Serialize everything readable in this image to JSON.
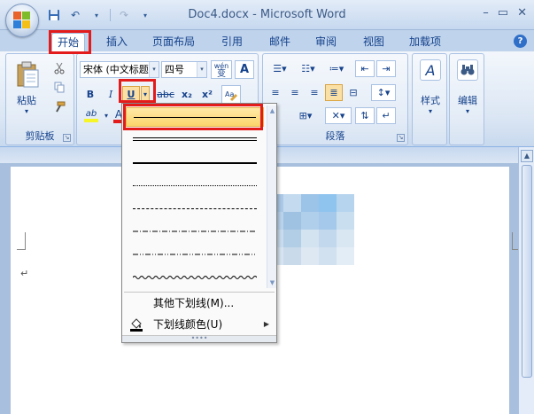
{
  "window": {
    "title": "Doc4.docx - Microsoft Word",
    "minimize": "–",
    "restore": "▭",
    "close": "✕"
  },
  "qat": {
    "save_icon": "save-icon",
    "undo_icon": "undo-icon",
    "redo_icon": "redo-icon",
    "customize_icon": "customize-qat-icon"
  },
  "tabs": [
    {
      "label": "开始",
      "active": true
    },
    {
      "label": "插入"
    },
    {
      "label": "页面布局"
    },
    {
      "label": "引用"
    },
    {
      "label": "邮件"
    },
    {
      "label": "审阅"
    },
    {
      "label": "视图"
    },
    {
      "label": "加载项"
    }
  ],
  "help_label": "?",
  "ribbon": {
    "clipboard": {
      "paste_label": "粘贴",
      "group_label": "剪贴板"
    },
    "font": {
      "font_name": "宋体 (中文标题",
      "font_size": "四号",
      "wen_label": "wén",
      "wen_char": "变",
      "bold": "B",
      "italic": "I",
      "underline": "U",
      "strike": "abc",
      "subscript": "x₂",
      "superscript": "x²",
      "highlight": "ab",
      "font_color": "A"
    },
    "paragraph": {
      "group_label": "段落"
    },
    "styles": {
      "label": "样式",
      "icon_letter": "A"
    },
    "editing": {
      "label": "编辑",
      "icon": "binoculars-icon"
    }
  },
  "dropdown": {
    "line_styles": [
      "single",
      "double",
      "thick",
      "dotted",
      "dashed",
      "dash-dot",
      "dash-dot-dot",
      "wave"
    ],
    "more_underlines": "其他下划线(M)...",
    "underline_color": "下划线颜色(U)",
    "grip": "••••"
  },
  "document": {
    "paragraph_mark": "↵"
  },
  "colors": {
    "accent_red": "#e31b1b",
    "ribbon_blue": "#15428b",
    "selected_bg": "#fbd46b"
  }
}
